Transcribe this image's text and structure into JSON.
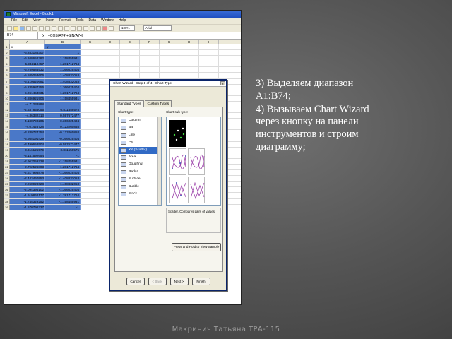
{
  "excel": {
    "window_title": "Microsoft Excel - Book1",
    "menu": [
      "File",
      "Edit",
      "View",
      "Insert",
      "Format",
      "Tools",
      "Data",
      "Window",
      "Help"
    ],
    "zoom": "100%",
    "font": "Arial",
    "name_box": "B74",
    "fx_label": "fx",
    "formula": "=COS(A74)+SIN(A74)",
    "columns": [
      "A",
      "B",
      "C",
      "D",
      "E",
      "F",
      "G",
      "H",
      "I"
    ],
    "rows": [
      {
        "n": "1",
        "a": "x",
        "b": "y"
      },
      {
        "n": "2",
        "a": "-6.283185307",
        "b": "1"
      },
      {
        "n": "3",
        "a": "-6.108652382",
        "b": "1.158455931"
      },
      {
        "n": "4",
        "a": "-5.934119457",
        "b": "1.281712764"
      },
      {
        "n": "5",
        "a": "-5.759586532",
        "b": "1.366025404"
      },
      {
        "n": "6",
        "a": "-5.585053606",
        "b": "1.408832053"
      },
      {
        "n": "7",
        "a": "-5.410520681",
        "b": "1.408832053"
      },
      {
        "n": "8",
        "a": "-5.235987756",
        "b": "1.366025404"
      },
      {
        "n": "9",
        "a": "-5.061454831",
        "b": "1.281712764"
      },
      {
        "n": "10",
        "a": "-4.886921906",
        "b": "1.158455931"
      },
      {
        "n": "11",
        "a": "-4.71238898",
        "b": "1"
      },
      {
        "n": "12",
        "a": "-4.537856055",
        "b": "0.811559575"
      },
      {
        "n": "13",
        "a": "-4.36332313",
        "b": "0.597672477"
      },
      {
        "n": "14",
        "a": "-4.188790205",
        "b": "0.366025404"
      },
      {
        "n": "15",
        "a": "-4.01425728",
        "b": "0.123260858"
      },
      {
        "n": "16",
        "a": "-3.839724354",
        "b": "-0.123260858"
      },
      {
        "n": "17",
        "a": "-3.665191429",
        "b": "-0.366025404"
      },
      {
        "n": "18",
        "a": "-3.490658504",
        "b": "-0.597672477"
      },
      {
        "n": "19",
        "a": "-3.316125579",
        "b": "-0.811559575"
      },
      {
        "n": "20",
        "a": "-3.141592654",
        "b": "-1"
      },
      {
        "n": "21",
        "a": "-2.967059728",
        "b": "-1.158455931"
      },
      {
        "n": "22",
        "a": "-2.792526803",
        "b": "-1.281712764"
      },
      {
        "n": "23",
        "a": "-2.617993878",
        "b": "-1.366025404"
      },
      {
        "n": "24",
        "a": "-2.443460953",
        "b": "-1.408832053"
      },
      {
        "n": "25",
        "a": "-2.268928028",
        "b": "-1.408832053"
      },
      {
        "n": "26",
        "a": "-2.094395102",
        "b": "-1.366025404"
      },
      {
        "n": "27",
        "a": "-1.919862177",
        "b": "-1.281712764"
      },
      {
        "n": "28",
        "a": "-1.745329252",
        "b": "-1.158455931"
      },
      {
        "n": "29",
        "a": "-1.570796327",
        "b": "-1"
      }
    ]
  },
  "wizard": {
    "title": "Chart Wizard - Step 1 of 4 - Chart Type",
    "close": "x",
    "tabs": [
      "Standard Types",
      "Custom Types"
    ],
    "chart_type_label": "Chart type:",
    "subtype_label": "Chart sub-type:",
    "chart_types": [
      "Column",
      "Bar",
      "Line",
      "Pie",
      "XY (Scatter)",
      "Area",
      "Doughnut",
      "Radar",
      "Surface",
      "Bubble",
      "Stock"
    ],
    "selected_type": "XY (Scatter)",
    "description": "Scatter. Compares pairs of values.",
    "hold_button": "Press and Hold to View Sample",
    "buttons": {
      "cancel": "Cancel",
      "back": "< Back",
      "next": "Next >",
      "finish": "Finish"
    }
  },
  "slide": {
    "lines": [
      "3) Выделяем диапазон A1:B74;",
      "4) Вызываем Chart Wizard через кнопку на панели инструментов и строим диаграмму;"
    ],
    "footer": "Макринич Татьяна   ТРА-115"
  },
  "colors": {
    "selection": "#4a78c8",
    "title_bar": "#1f4fc0",
    "dialog_bg": "#ece9d8",
    "slide_bg": "#565656"
  }
}
